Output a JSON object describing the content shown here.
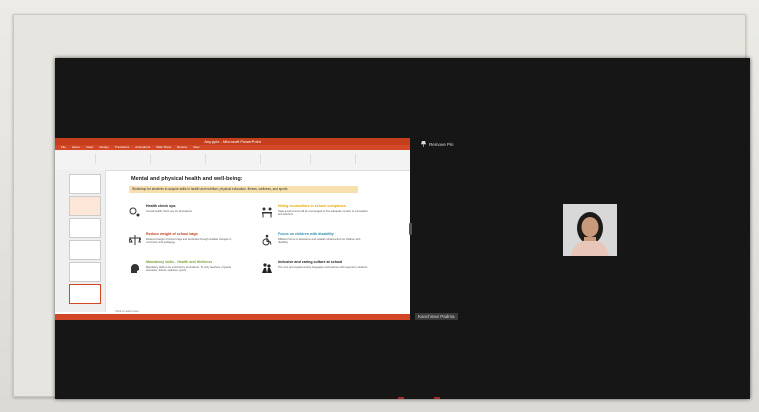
{
  "window": {
    "title": "Any.pptx - Microsoft PowerPoint"
  },
  "ribbon": {
    "tabs": [
      "File",
      "Home",
      "Insert",
      "Design",
      "Transitions",
      "Animations",
      "Slide Show",
      "Review",
      "View"
    ]
  },
  "slide": {
    "title": "Mental and physical health and well-being:",
    "subtitle": "Workshop for students to acquire skills in health and nutrition; physical education, fitness, wellness, and sports",
    "items": [
      {
        "heading": "Health check ups",
        "body": "Annual health check ups for all students"
      },
      {
        "heading": "Reduce weight of school bags",
        "body": "Reduced weight of school bags and textbooks through suitable changes in curriculum and pedagogy"
      },
      {
        "heading": "Mandatory skills - Health and Wellness",
        "body": "Mandatory skills to be enriched by all students. To unify teachers, physical education, fitness, wellness, sports"
      },
      {
        "heading": "Hiring counsellors in school complexes",
        "body": "State governments will be encouraged to hire adequate number of counsellors and teachers"
      },
      {
        "heading": "Focus on children with disability",
        "body": "Different forms of assistance and suitable infrastructure for children with disability"
      },
      {
        "heading": "Inclusive and caring culture at school",
        "body": "The core and supplementary languages and teachers will respond to students"
      }
    ],
    "notes": "Click to add notes"
  },
  "meeting": {
    "pin_label": "Remove Pin",
    "participant_name": "Kanchiravi Padma"
  },
  "colors": {
    "accent": "#d24726",
    "screen": "#161616"
  }
}
